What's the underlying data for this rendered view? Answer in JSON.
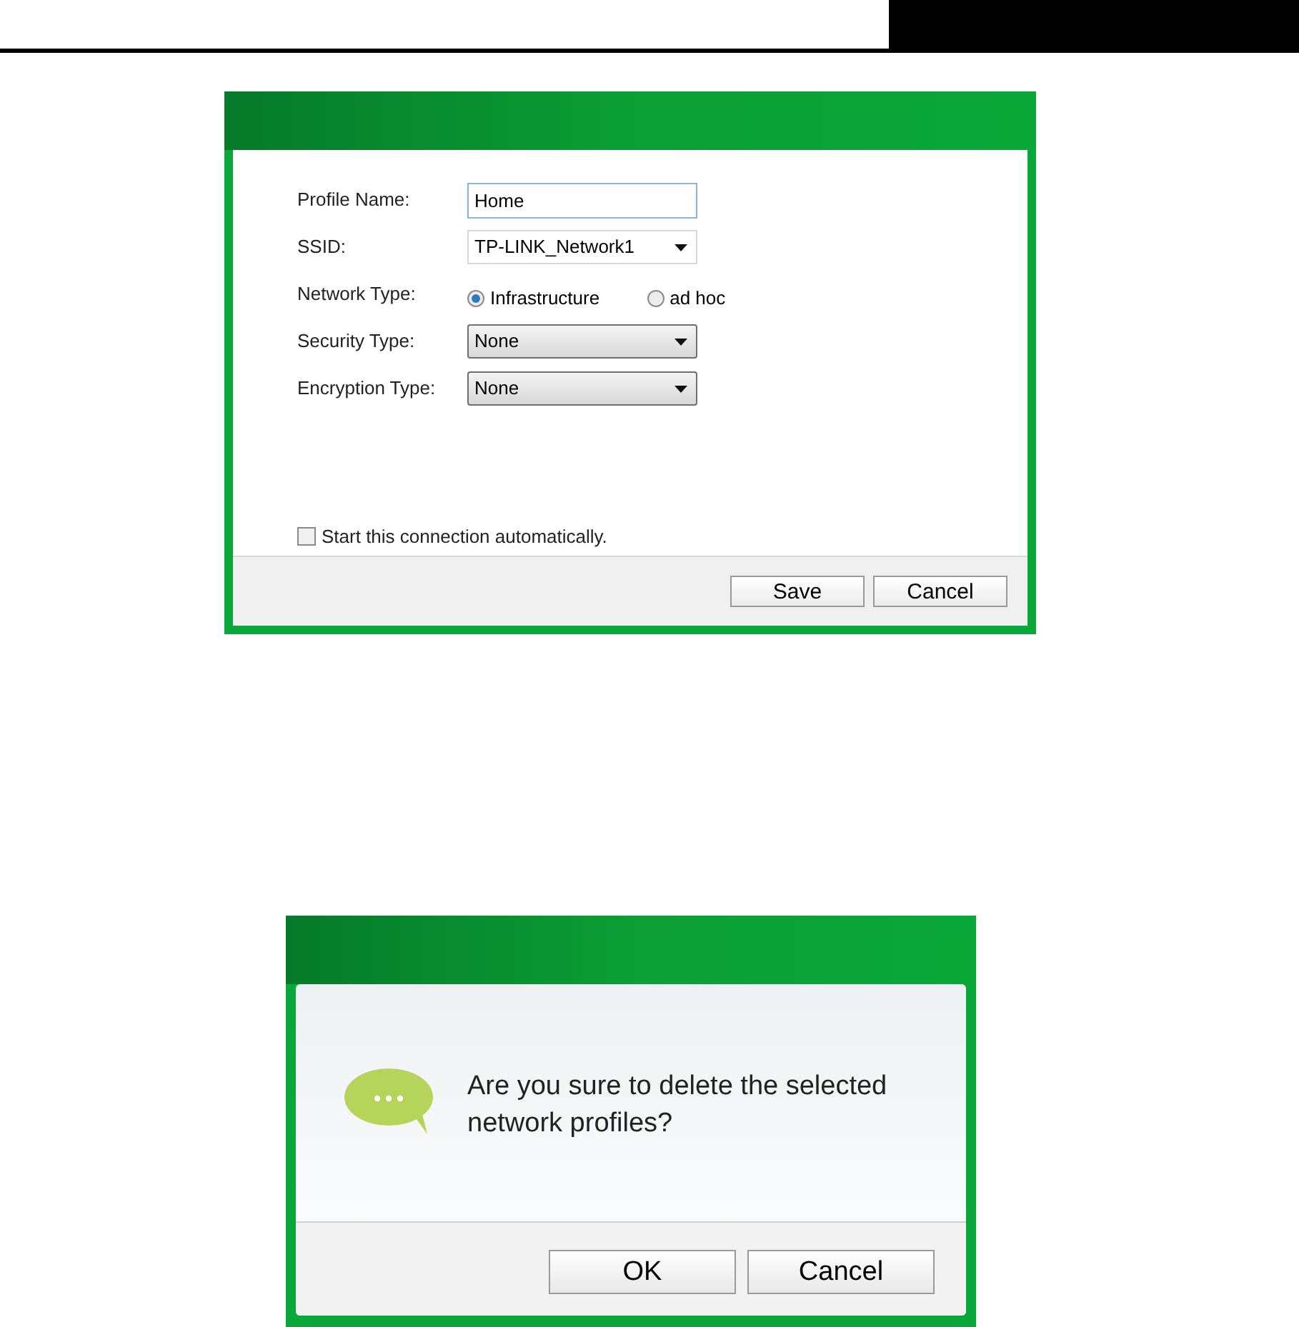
{
  "profile_dialog": {
    "fields": [
      {
        "kind": "text",
        "label": "Profile Name:",
        "value": "Home"
      },
      {
        "kind": "combo",
        "label": "SSID:",
        "value": "TP-LINK_Network1"
      },
      {
        "kind": "radio",
        "label": "Network Type:",
        "options": [
          {
            "label": "Infrastructure",
            "selected": true
          },
          {
            "label": "ad hoc",
            "selected": false
          }
        ]
      },
      {
        "kind": "select",
        "label": "Security Type:",
        "value": "None"
      },
      {
        "kind": "select",
        "label": "Encryption Type:",
        "value": "None"
      }
    ],
    "auto_connect": {
      "label": "Start this connection automatically.",
      "checked": false
    },
    "buttons": [
      "Save",
      "Cancel"
    ]
  },
  "confirm_dialog": {
    "message": "Are you sure to delete the selected network profiles?",
    "buttons": [
      "OK",
      "Cancel"
    ]
  }
}
